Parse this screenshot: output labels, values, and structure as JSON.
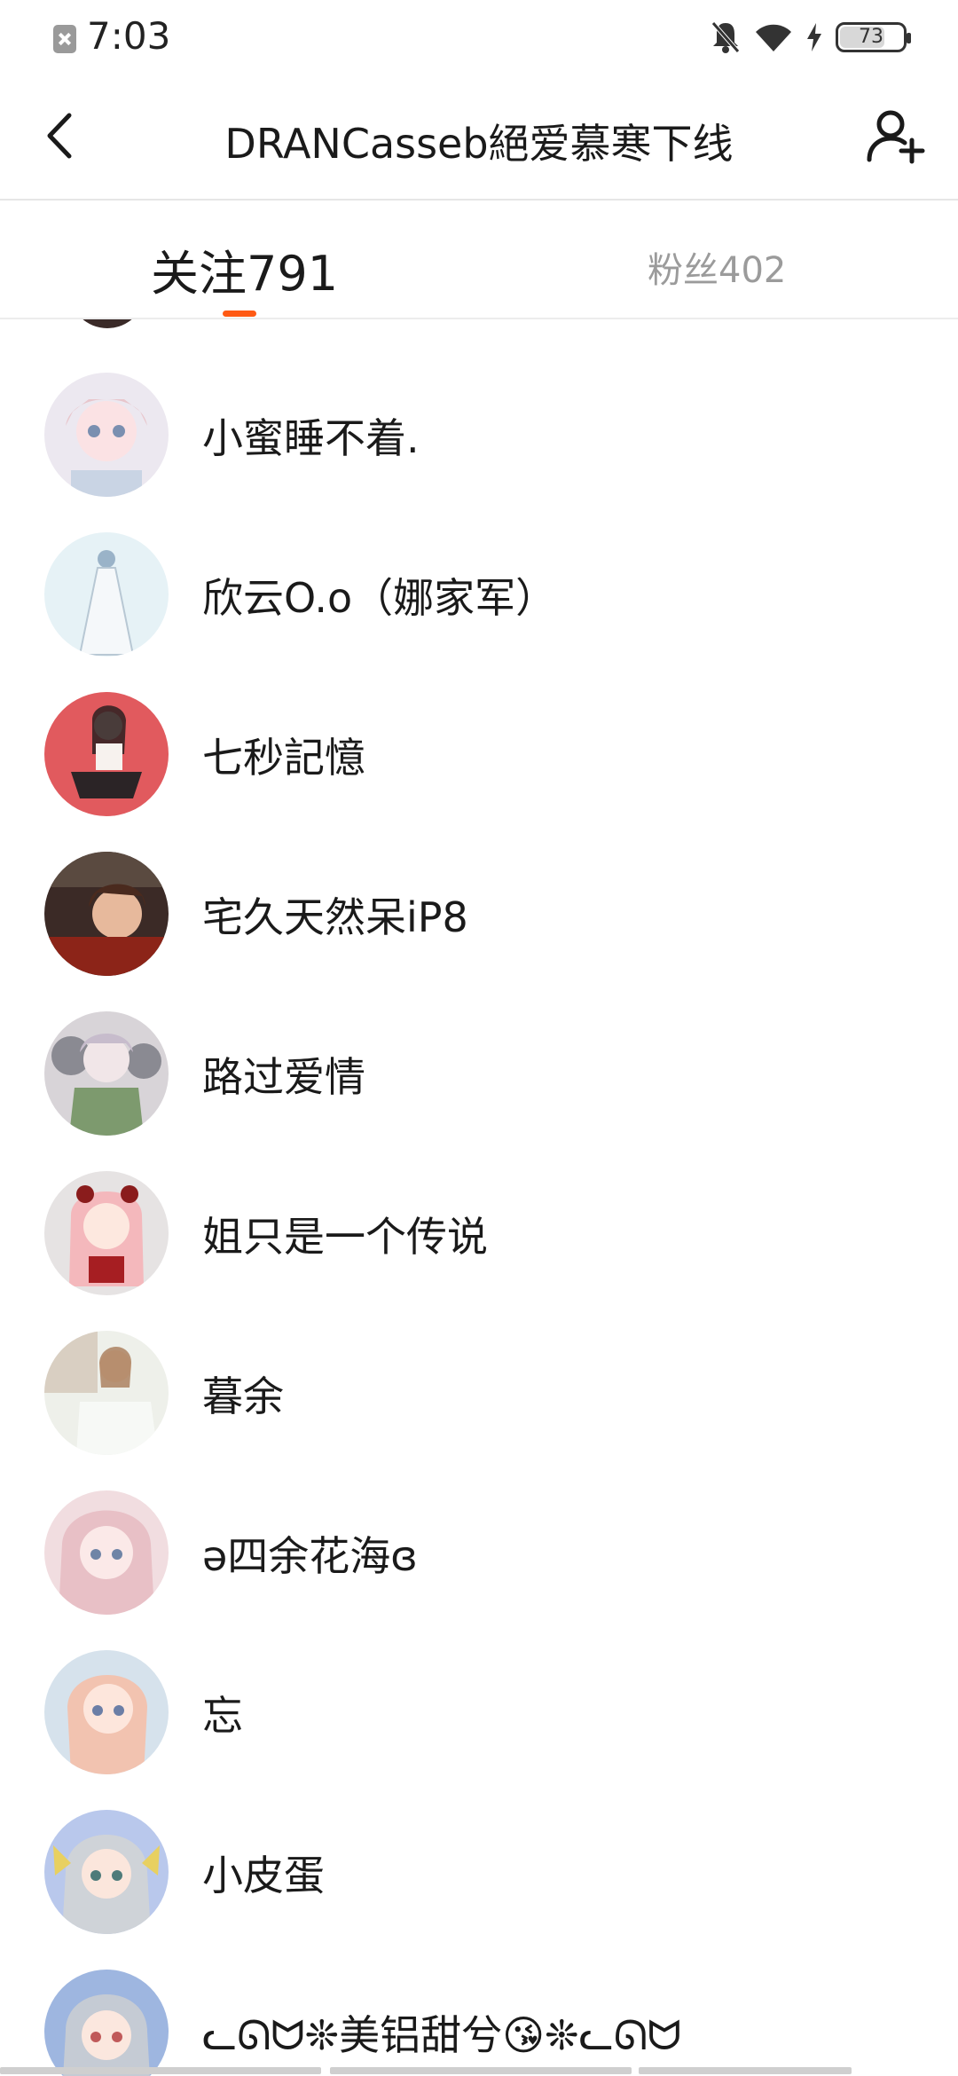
{
  "status_bar": {
    "time": "7:03",
    "battery": "73",
    "battery_percent": 73,
    "icons": [
      "notification-blocked-icon",
      "bell-off-icon",
      "wifi-icon",
      "charging-icon",
      "battery-icon"
    ]
  },
  "header": {
    "title": "DRANCasseb絕爱慕寒下线",
    "back_icon": "chevron-left-icon",
    "add_icon": "add-user-icon"
  },
  "tabs": [
    {
      "label": "关注791"
    },
    {
      "label": "粉丝402"
    }
  ],
  "active_tab_color": "#ff5a14",
  "users": [
    {
      "name": "小蜜睡不着."
    },
    {
      "name": "欣云O.o（娜家军）"
    },
    {
      "name": "七秒記憶"
    },
    {
      "name": "宅久天然呆iP8"
    },
    {
      "name": "路过爱情"
    },
    {
      "name": "姐只是一个传说"
    },
    {
      "name": "暮余"
    },
    {
      "name": "ə四余花海ɞ"
    },
    {
      "name": "忘"
    },
    {
      "name": "小皮蛋"
    },
    {
      "name": "ᓚᘏᗢ❊美铝甜兮😘❊ᓚᘏᗢ"
    }
  ]
}
